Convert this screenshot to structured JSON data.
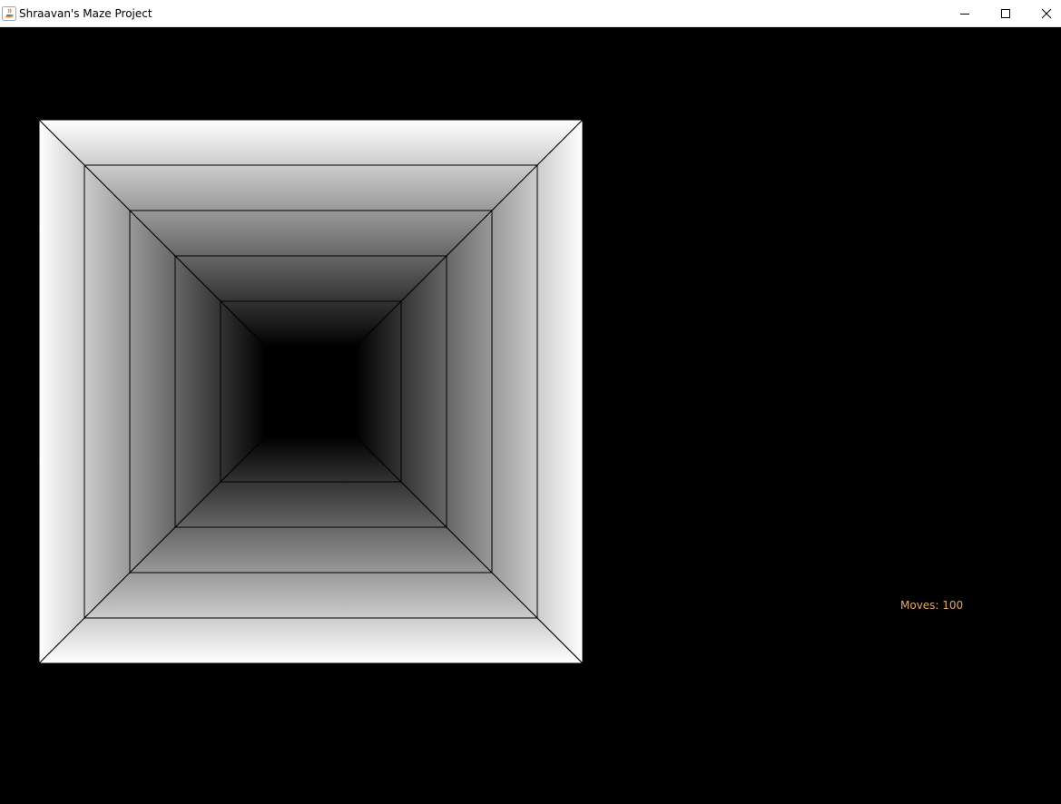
{
  "window": {
    "title": "Shraavan's Maze Project"
  },
  "titlebar_buttons": {
    "minimize_icon": "minimize-icon",
    "maximize_icon": "maximize-icon",
    "close_icon": "close-icon"
  },
  "hud": {
    "moves_text": "Moves: 100",
    "moves_color": "#e0a96d"
  },
  "maze_view": {
    "depth_layers": 6,
    "far_wall_color": "#000000",
    "near_shade_color": "#ffffff",
    "line_color": "#000000"
  }
}
